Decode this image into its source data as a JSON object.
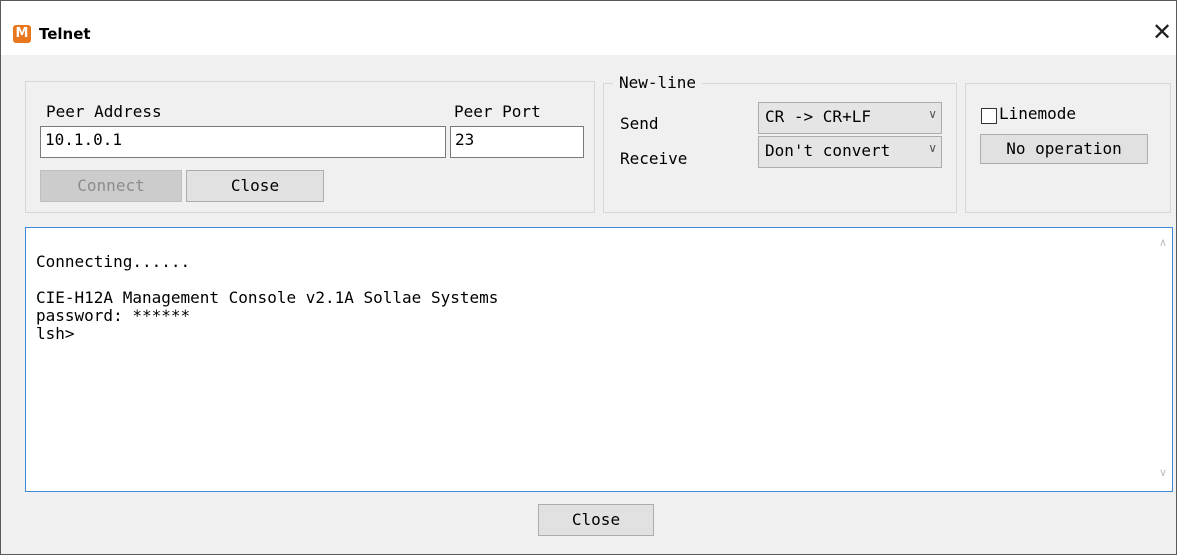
{
  "window": {
    "title": "Telnet",
    "icon_letter": "M",
    "close_glyph": "✕"
  },
  "connection": {
    "peer_address_label": "Peer Address",
    "peer_address_value": "10.1.0.1",
    "peer_port_label": "Peer Port",
    "peer_port_value": "23",
    "connect_label": "Connect",
    "close_label": "Close"
  },
  "newline": {
    "group_label": "New-line",
    "send_label": "Send",
    "send_value": "CR -> CR+LF",
    "receive_label": "Receive",
    "receive_value": "Don't convert"
  },
  "linemode": {
    "checkbox_label": "Linemode",
    "checked": false,
    "operation_label": "No operation"
  },
  "console": {
    "lines": [
      "Connecting......",
      "",
      "CIE-H12A Management Console v2.1A Sollae Systems",
      "password: ******",
      "lsh>"
    ]
  },
  "footer": {
    "close_label": "Close"
  },
  "colors": {
    "accent": "#3c8ad9",
    "icon": "#e8771e",
    "background": "#f0f0f0"
  }
}
